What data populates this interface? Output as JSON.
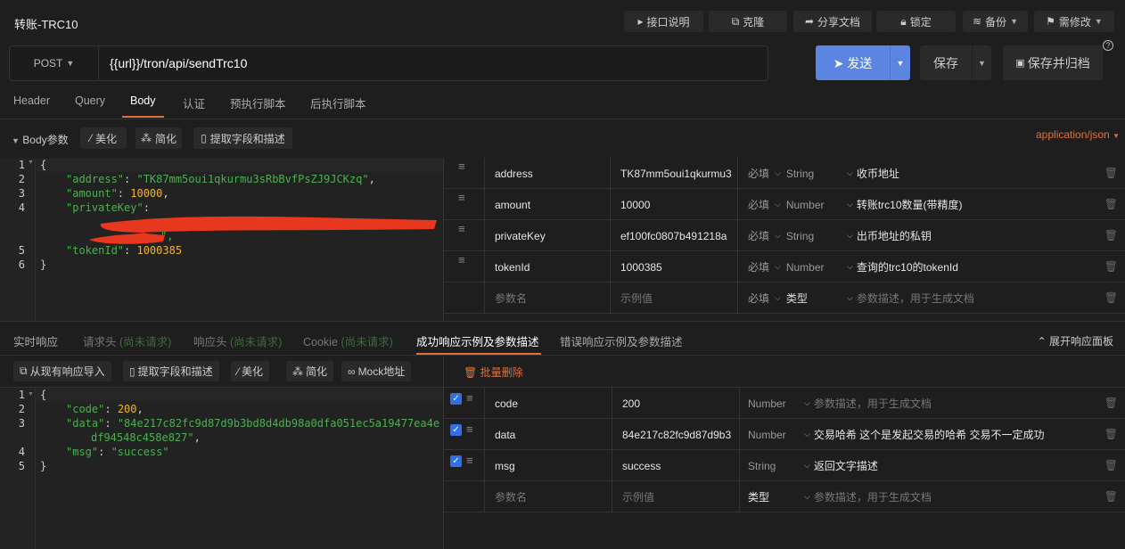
{
  "title": "转账-TRC10",
  "toolbar": {
    "doc": "接口说明",
    "clone": "克隆",
    "share": "分享文档",
    "lock": "锁定",
    "backup": "备份",
    "modify": "需修改"
  },
  "request": {
    "method": "POST",
    "url": "{{url}}/tron/api/sendTrc10",
    "send": "发送",
    "save": "保存",
    "save_archive": "保存并归档"
  },
  "tabs": [
    "Header",
    "Query",
    "Body",
    "认证",
    "预执行脚本",
    "后执行脚本"
  ],
  "active_tab": "Body",
  "body_bar": {
    "label": "Body参数",
    "beautify": "美化",
    "simplify": "简化",
    "extract": "提取字段和描述",
    "content_type": "application/json"
  },
  "body_code": {
    "line_numbers": [
      "1",
      "2",
      "3",
      "4",
      "5",
      "6"
    ],
    "l1": "{",
    "k_address": "\"address\"",
    "v_address": "\"TK87mm5oui1qkurmu3sRbBvfPsZJ9JCKzq\"",
    "k_amount": "\"amount\"",
    "v_amount": "10000",
    "k_private": "\"privateKey\"",
    "private_end": "\",",
    "k_token": "\"tokenId\"",
    "v_token": "1000385",
    "l6": "}"
  },
  "body_params": [
    {
      "name": "address",
      "value": "TK87mm5oui1qkurmu3",
      "required": "必填",
      "type": "String",
      "desc": "收币地址"
    },
    {
      "name": "amount",
      "value": "10000",
      "required": "必填",
      "type": "Number",
      "desc": "转账trc10数量(带精度)"
    },
    {
      "name": "privateKey",
      "value": "ef100fc0807b491218a",
      "required": "必填",
      "type": "String",
      "desc": "出币地址的私钥"
    },
    {
      "name": "tokenId",
      "value": "1000385",
      "required": "必填",
      "type": "Number",
      "desc": "查询的trc10的tokenId"
    }
  ],
  "body_new_row": {
    "name": "参数名",
    "value": "示例值",
    "required": "必填",
    "type": "类型",
    "desc": "参数描述，用于生成文档"
  },
  "resp_tabs": [
    {
      "label": "实时响应",
      "note": ""
    },
    {
      "label": "请求头",
      "note": "(尚未请求)"
    },
    {
      "label": "响应头",
      "note": "(尚未请求)"
    },
    {
      "label": "Cookie",
      "note": "(尚未请求)"
    },
    {
      "label": "成功响应示例及参数描述",
      "note": ""
    },
    {
      "label": "错误响应示例及参数描述",
      "note": ""
    }
  ],
  "expand_panel": "展开响应面板",
  "resp_bar": {
    "import": "从现有响应导入",
    "extract": "提取字段和描述",
    "beautify": "美化",
    "simplify": "简化",
    "mock": "Mock地址",
    "batch_delete": "批量删除"
  },
  "resp_code": {
    "line_numbers": [
      "1",
      "2",
      "3",
      "4",
      "5"
    ],
    "l1": "{",
    "k_code": "\"code\"",
    "v_code": "200",
    "k_data": "\"data\"",
    "v_data1": "\"84e217c82fc9d87d9b3bd8d4db98a0dfa051ec5a19477ea4e",
    "v_data2": "df94548c458e827\"",
    "k_msg": "\"msg\"",
    "v_msg": "\"success\"",
    "l5": "}"
  },
  "resp_params": [
    {
      "name": "code",
      "value": "200",
      "type": "Number",
      "desc": "参数描述，用于生成文档",
      "placeholder_desc": true,
      "checked": true
    },
    {
      "name": "data",
      "value": "84e217c82fc9d87d9b3",
      "type": "Number",
      "desc": "交易哈希 这个是发起交易的哈希 交易不一定成功",
      "checked": true
    },
    {
      "name": "msg",
      "value": "success",
      "type": "String",
      "desc": "返回文字描述",
      "checked": true
    }
  ],
  "resp_new_row": {
    "name": "参数名",
    "value": "示例值",
    "type": "类型",
    "desc": "参数描述，用于生成文档"
  },
  "colors": {
    "accent": "#e0703a",
    "send": "#5b85e0",
    "string": "#4caf50",
    "number": "#f0b429"
  }
}
